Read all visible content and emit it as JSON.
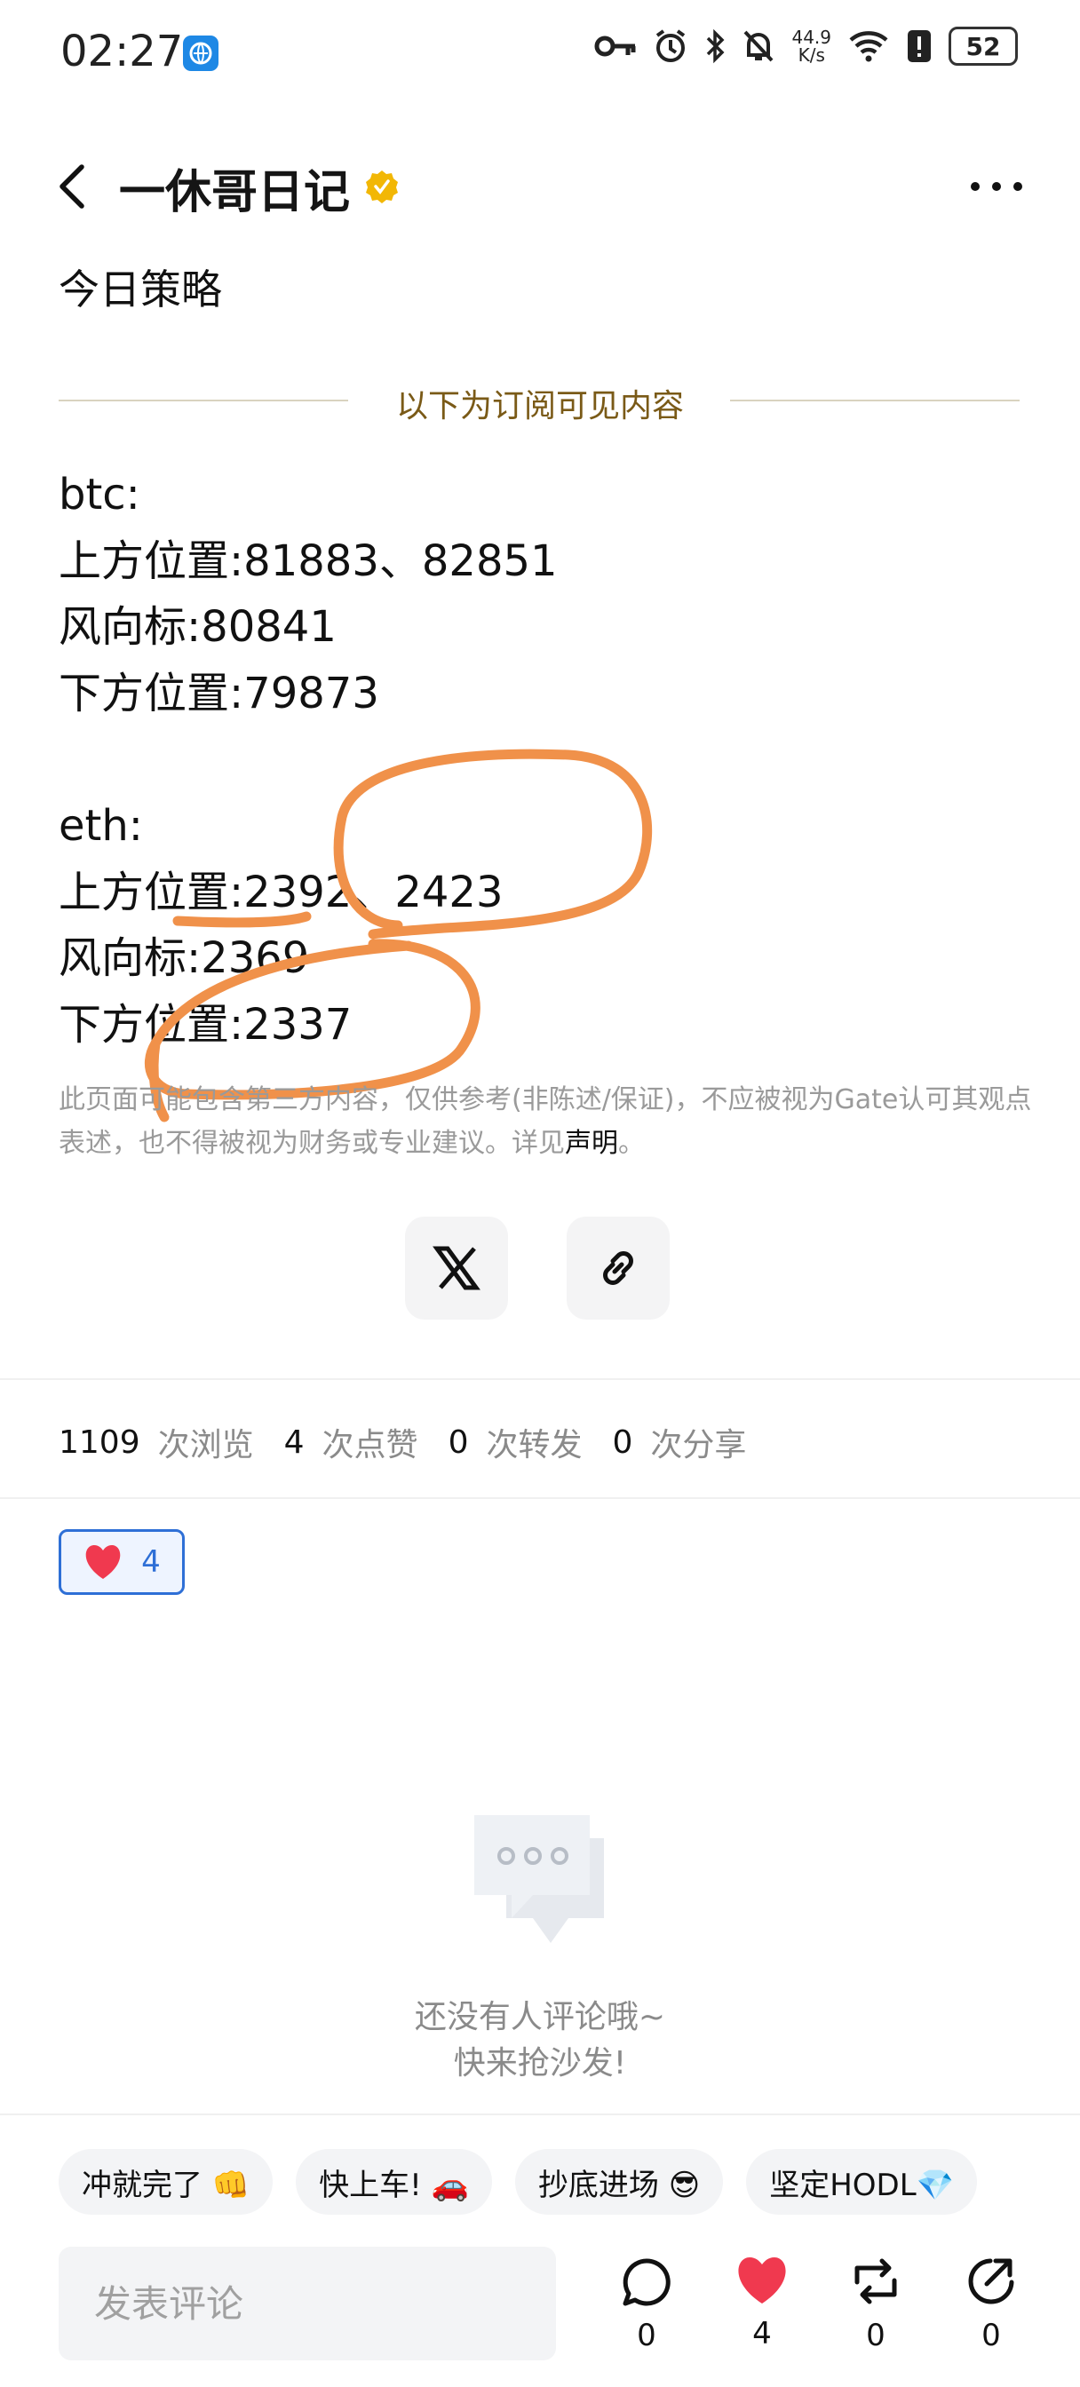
{
  "status_bar": {
    "time": "02:27",
    "speed_value": "44.9",
    "speed_unit": "K/s",
    "battery": "52"
  },
  "header": {
    "title": "一休哥日记"
  },
  "post": {
    "title": "今日策略",
    "subscriber_label": "以下为订阅可见内容",
    "lines": [
      "btc:",
      "上方位置:81883、82851",
      "风向标:80841",
      "下方位置:79873",
      "",
      "eth:",
      "上方位置:2392、2423",
      "风向标:2369",
      "下方位置:2337"
    ],
    "disclaimer_text": "此页面可能包含第三方内容，仅供参考(非陈述/保证)，不应被视为Gate认可其观点表述，也不得被视为财务或专业建议。详见",
    "disclaimer_link": "声明",
    "disclaimer_end": "。"
  },
  "stats": {
    "views": "1109",
    "views_label": "次浏览",
    "likes": "4",
    "likes_label": "次点赞",
    "reposts": "0",
    "reposts_label": "次转发",
    "shares": "0",
    "shares_label": "次分享"
  },
  "reaction": {
    "count": "4"
  },
  "empty_state": {
    "line1": "还没有人评论哦~",
    "line2": "快来抢沙发!"
  },
  "quick_replies": [
    "冲就完了 👊",
    "快上车! 🚗",
    "抄底进场 😎",
    "坚定HODL💎"
  ],
  "bottom_bar": {
    "comment_placeholder": "发表评论",
    "comment_count": "0",
    "like_count": "4",
    "repost_count": "0",
    "share_count": "0"
  },
  "colors": {
    "accent_gold": "#7a5a17",
    "annotation_orange": "#f0914a",
    "like_red": "#f0394f",
    "link_blue": "#2e6fd6"
  }
}
